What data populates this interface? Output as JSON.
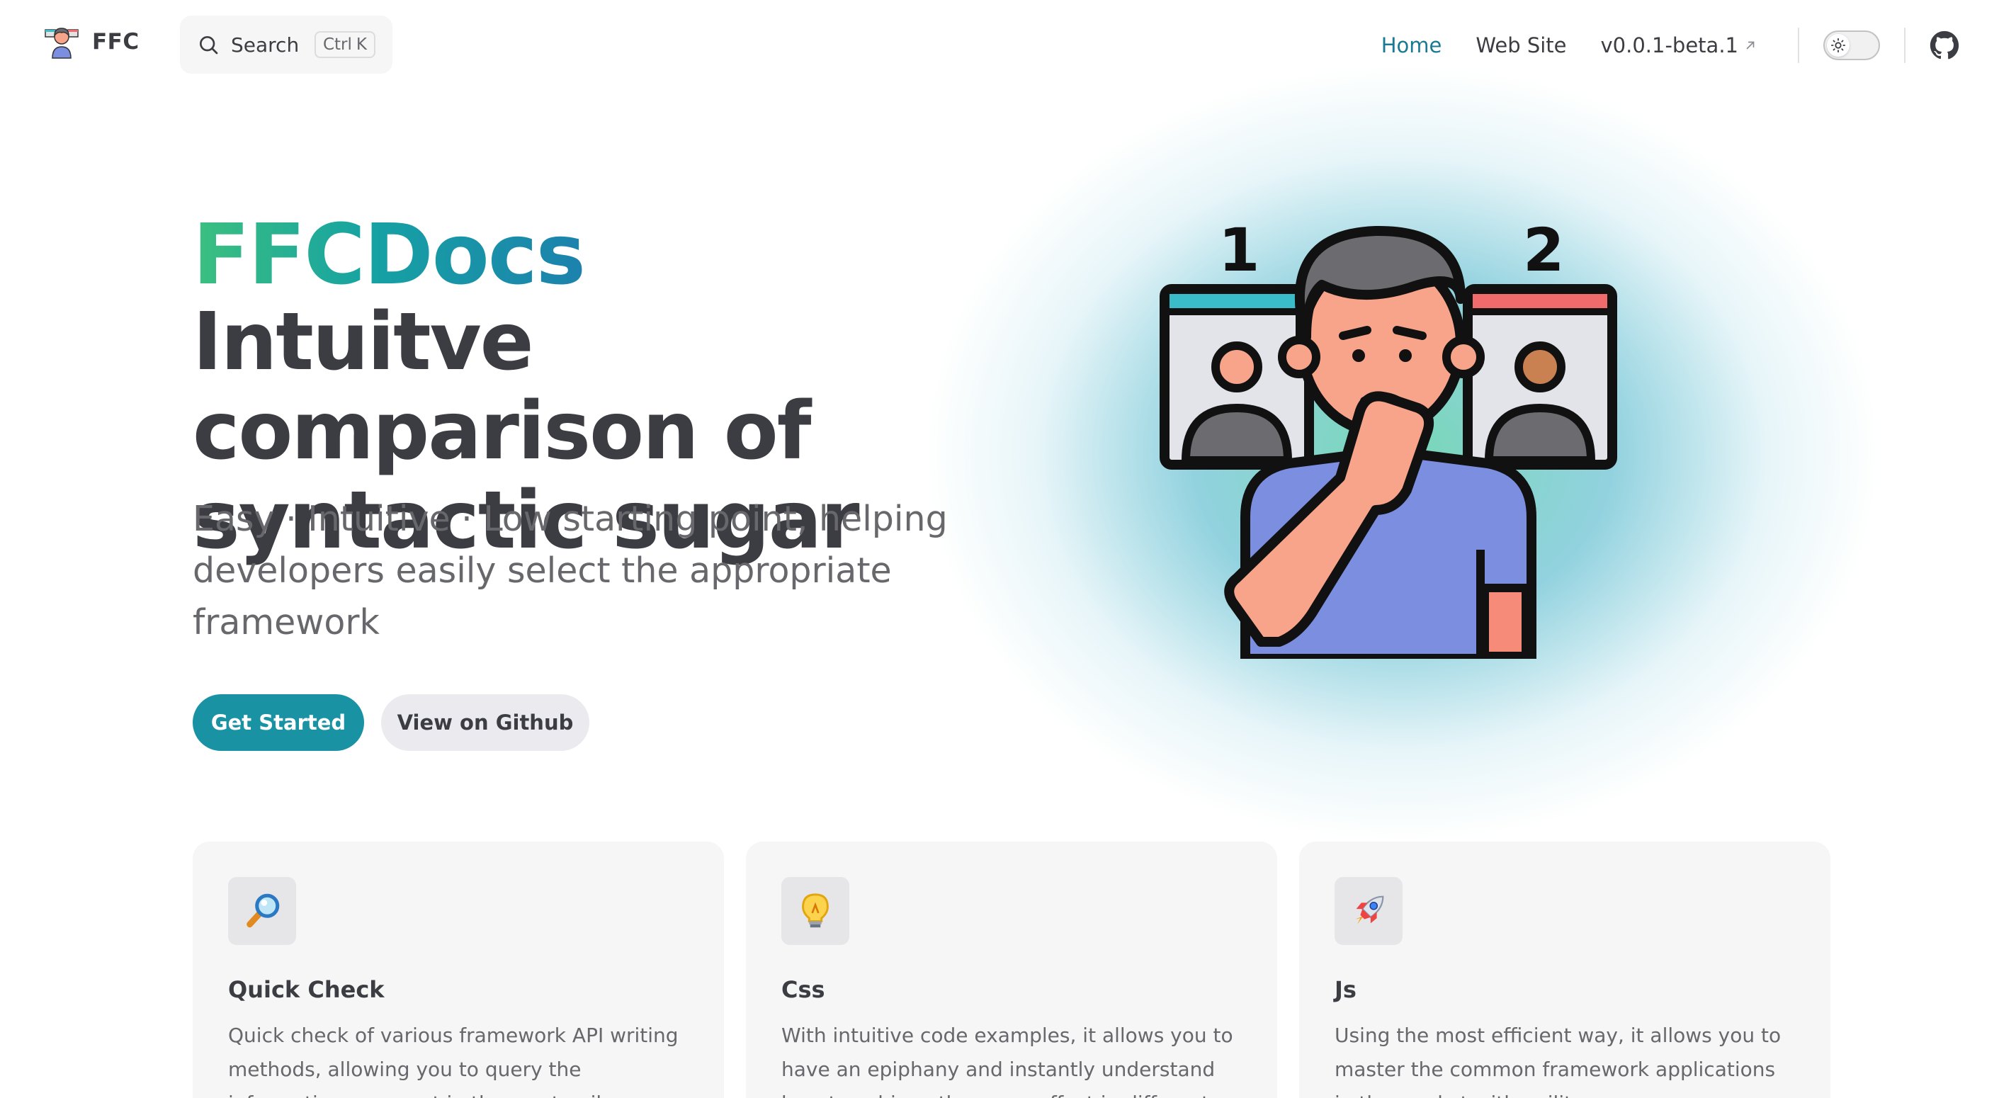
{
  "nav": {
    "brand_name": "FFC",
    "search_label": "Search",
    "search_kbd_mod": "Ctrl",
    "search_kbd_key": "K",
    "links": [
      {
        "label": "Home",
        "active": true
      },
      {
        "label": "Web Site",
        "active": false
      },
      {
        "label": "v0.0.1-beta.1",
        "active": false,
        "external": true
      }
    ],
    "theme_icon": "sun-icon",
    "github_icon": "github-icon"
  },
  "hero": {
    "name": "FFCDocs",
    "text": "Intuitve comparison of syntactic sugar",
    "tagline": "Easy · Intuitive · Low starting point, helping developers easily select the appropriate framework",
    "actions": [
      {
        "label": "Get Started",
        "theme": "brand"
      },
      {
        "label": "View on Github",
        "theme": "alt"
      }
    ],
    "image_numbers": [
      "1",
      "2"
    ]
  },
  "features": [
    {
      "icon": "magnifier-icon",
      "title": "Quick Check",
      "details": "Quick check of various framework API writing methods, allowing you to query the information you want in the most agile way."
    },
    {
      "icon": "lightbulb-icon",
      "title": "Css",
      "details": "With intuitive code examples, it allows you to have an epiphany and instantly understand how to achieve the same effect in different"
    },
    {
      "icon": "rocket-icon",
      "title": "Js",
      "details": "Using the most efficient way, it allows you to master the common framework applications in the market with agility."
    }
  ],
  "colors": {
    "brand": "#1993a3",
    "active_link": "#1a7a93",
    "text": "#3c3c43",
    "muted": "#67676c"
  }
}
